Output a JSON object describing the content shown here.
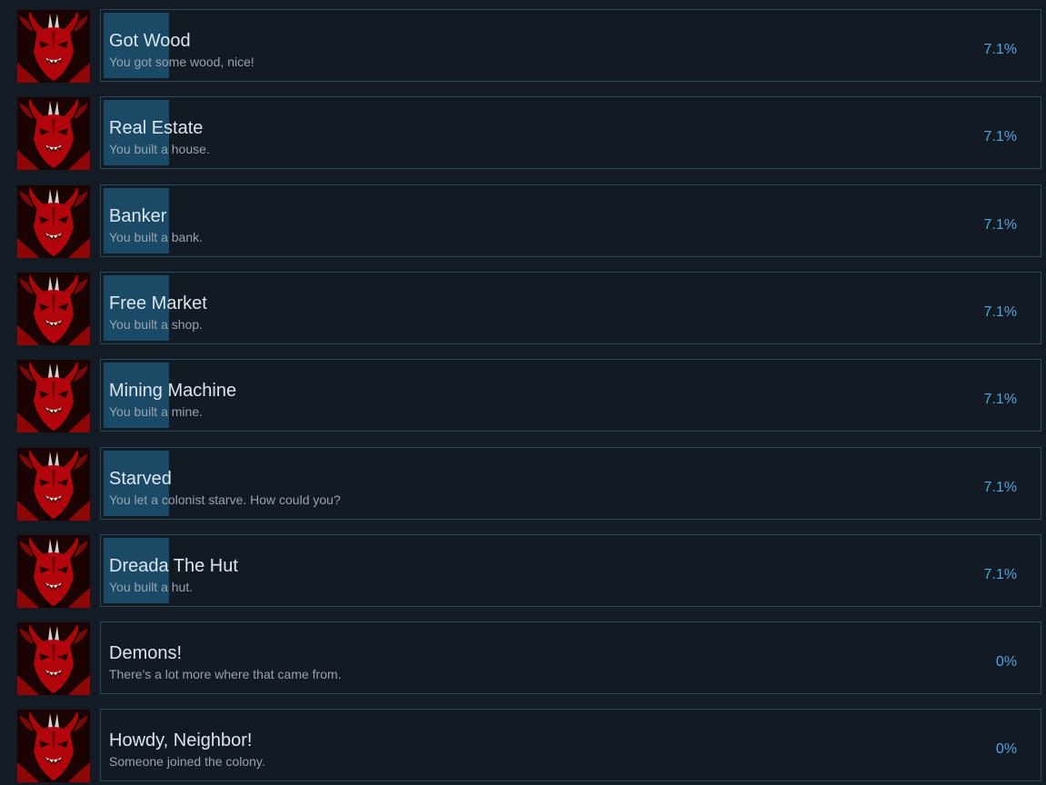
{
  "achievements": [
    {
      "title": "Got Wood",
      "description": "You got some wood, nice!",
      "percent": "7.1%",
      "unlocked_fraction": 0.071,
      "icon": "red-demon-icon"
    },
    {
      "title": "Real Estate",
      "description": "You built a house.",
      "percent": "7.1%",
      "unlocked_fraction": 0.071,
      "icon": "red-demon-icon"
    },
    {
      "title": "Banker",
      "description": "You built a bank.",
      "percent": "7.1%",
      "unlocked_fraction": 0.071,
      "icon": "red-demon-icon"
    },
    {
      "title": "Free Market",
      "description": "You built a shop.",
      "percent": "7.1%",
      "unlocked_fraction": 0.071,
      "icon": "red-demon-icon"
    },
    {
      "title": "Mining Machine",
      "description": "You built a mine.",
      "percent": "7.1%",
      "unlocked_fraction": 0.071,
      "icon": "red-demon-icon"
    },
    {
      "title": "Starved",
      "description": "You let a colonist starve. How could you?",
      "percent": "7.1%",
      "unlocked_fraction": 0.071,
      "icon": "red-demon-icon"
    },
    {
      "title": "Dreada The Hut",
      "description": "You built a hut.",
      "percent": "7.1%",
      "unlocked_fraction": 0.071,
      "icon": "red-demon-icon"
    },
    {
      "title": "Demons!",
      "description": "There's a lot more where that came from.",
      "percent": "0%",
      "unlocked_fraction": 0,
      "icon": "red-demon-icon"
    },
    {
      "title": "Howdy, Neighbor!",
      "description": "Someone joined the colony.",
      "percent": "0%",
      "unlocked_fraction": 0,
      "icon": "red-demon-icon"
    }
  ],
  "colors": {
    "background": "#131b24",
    "panel_border": "#2a4a5c",
    "progress_fill": "#1b4a67",
    "percent_text": "#53a4dd",
    "icon_red": "#b3060c"
  }
}
